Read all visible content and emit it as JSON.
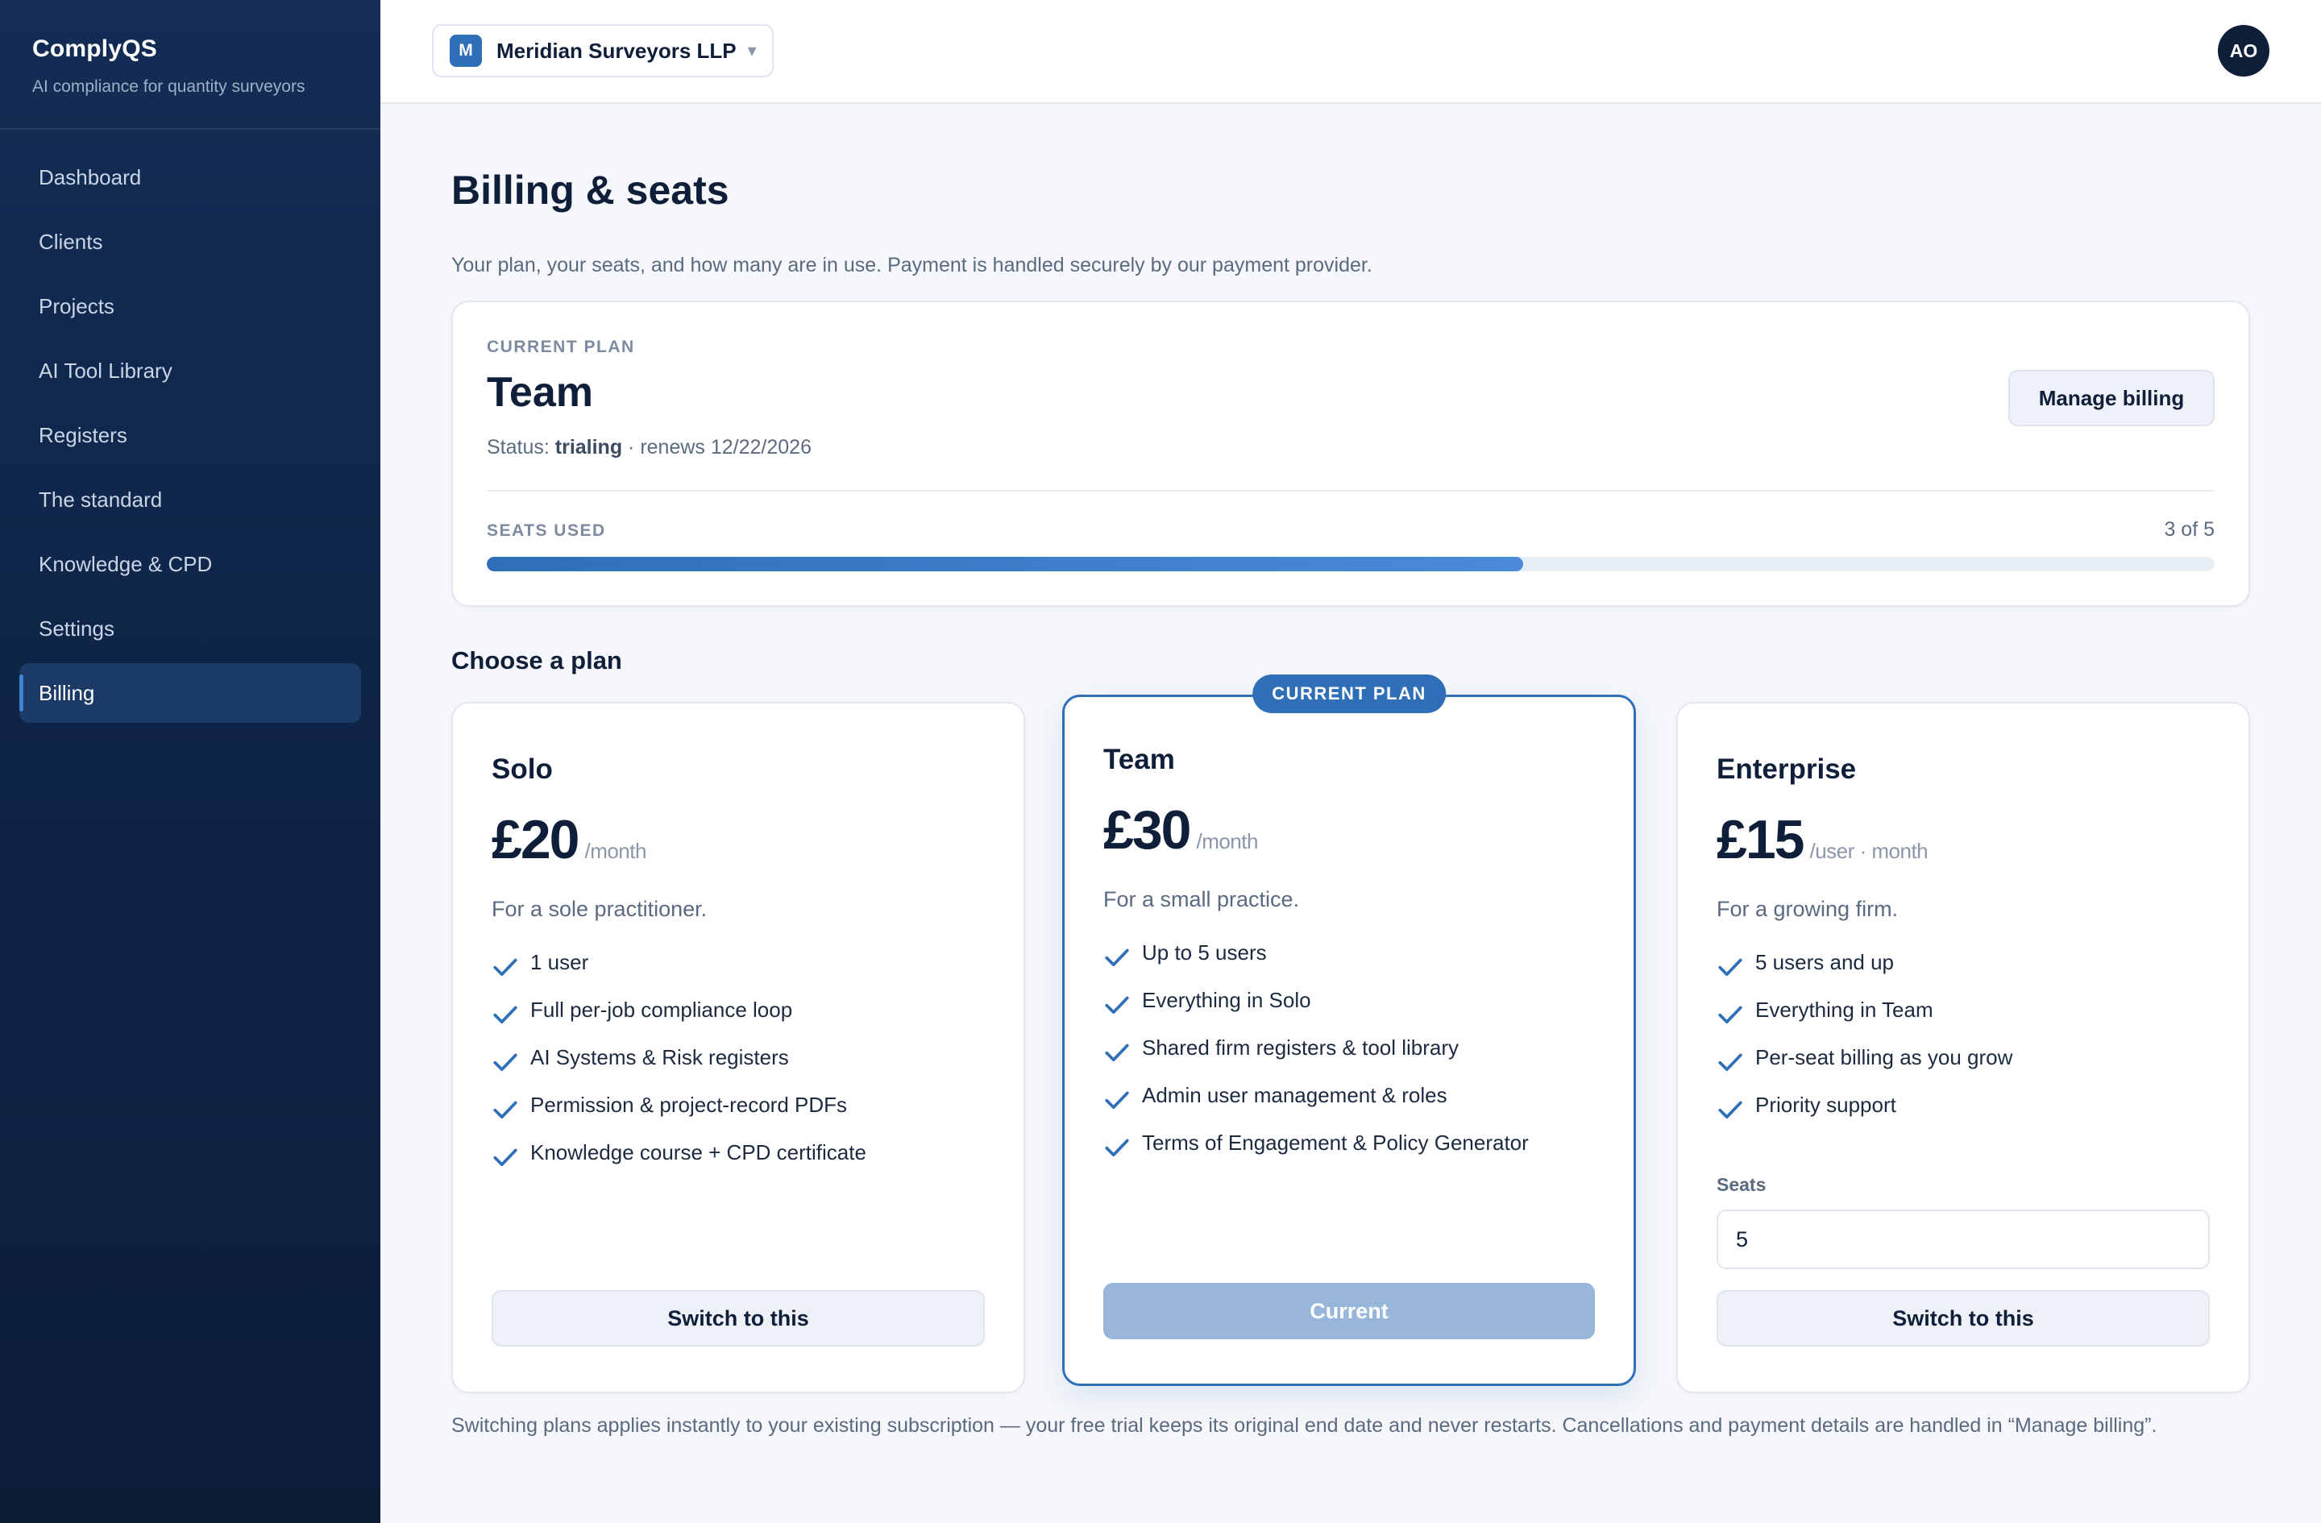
{
  "app": {
    "name": "ComplyQS",
    "tagline": "AI compliance for quantity surveyors"
  },
  "sidebar": {
    "items": [
      {
        "label": "Dashboard",
        "active": false
      },
      {
        "label": "Clients",
        "active": false
      },
      {
        "label": "Projects",
        "active": false
      },
      {
        "label": "AI Tool Library",
        "active": false
      },
      {
        "label": "Registers",
        "active": false
      },
      {
        "label": "The standard",
        "active": false
      },
      {
        "label": "Knowledge & CPD",
        "active": false
      },
      {
        "label": "Settings",
        "active": false
      },
      {
        "label": "Billing",
        "active": true
      }
    ]
  },
  "topbar": {
    "org_initial": "M",
    "org_name": "Meridian Surveyors LLP",
    "org_caret": "▾",
    "avatar_initials": "AO"
  },
  "page": {
    "title": "Billing & seats",
    "subtitle": "Your plan, your seats, and how many are in use. Payment is handled securely by our payment provider."
  },
  "current_plan": {
    "label": "CURRENT PLAN",
    "name": "Team",
    "status_prefix": "Status: ",
    "status": "trialing",
    "renews": " · renews 12/22/2026",
    "manage_button": "Manage billing",
    "seats_label": "SEATS USED",
    "seats_text": "3 of 5",
    "seats_used": 3,
    "seats_total": 5
  },
  "plans_heading": "Choose a plan",
  "plans": {
    "solo": {
      "title": "Solo",
      "amount": "£20",
      "unit": "/month",
      "description": "For a sole practitioner.",
      "features": [
        "1 user",
        "Full per-job compliance loop",
        "AI Systems & Risk registers",
        "Permission & project-record PDFs",
        "Knowledge course + CPD certificate"
      ],
      "button": "Switch to this"
    },
    "team": {
      "badge": "CURRENT PLAN",
      "title": "Team",
      "amount": "£30",
      "unit": "/month",
      "description": "For a small practice.",
      "features": [
        "Up to 5 users",
        "Everything in Solo",
        "Shared firm registers & tool library",
        "Admin user management & roles",
        "Terms of Engagement & Policy Generator"
      ],
      "button": "Current"
    },
    "enterprise": {
      "title": "Enterprise",
      "amount": "£15",
      "unit": "/user · month",
      "description": "For a growing firm.",
      "features": [
        "5 users and up",
        "Everything in Team",
        "Per-seat billing as you grow",
        "Priority support"
      ],
      "seats_label": "Seats",
      "seats_value": "5",
      "button": "Switch to this"
    }
  },
  "footnote": "Switching plans applies instantly to your existing subscription — your free trial keeps its original end date and never restarts. Cancellations and payment details are handled in “Manage billing”.",
  "colors": {
    "accent": "#2f6fb8",
    "sidebar": "#0e2344",
    "text": "#0f1f3a"
  },
  "icons": {
    "feature": "check-icon",
    "org_caret": "chevron-down-icon"
  }
}
